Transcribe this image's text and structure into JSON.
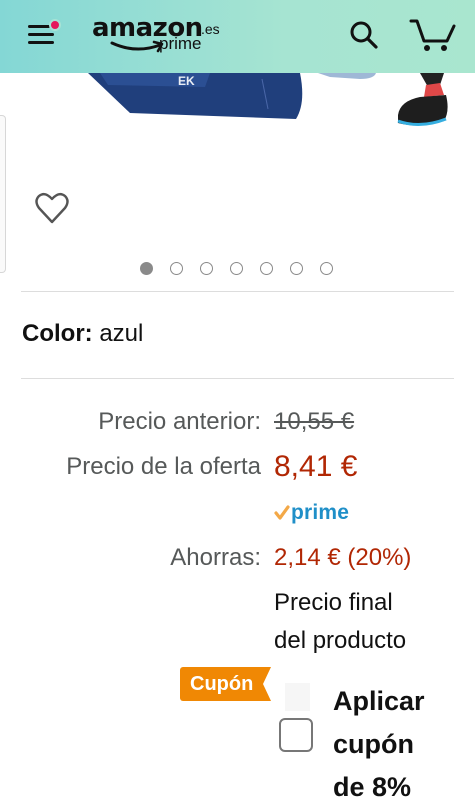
{
  "header": {
    "logo_word": "amazon",
    "logo_tld": ".es",
    "logo_prime": "prime",
    "colors": {
      "gradient_start": "#84d7d5",
      "gradient_end": "#a9e6cf",
      "notification": "#e5185c"
    },
    "icons": [
      "menu-icon",
      "search-icon",
      "cart-icon"
    ]
  },
  "gallery": {
    "total_images": 7,
    "active_index": 0,
    "favorite_icon": "heart-outline-icon"
  },
  "color": {
    "label": "Color:",
    "value": "azul"
  },
  "price": {
    "previous_label": "Precio anterior:",
    "previous_value": "10,55 €",
    "deal_label": "Precio de la oferta",
    "deal_value": "8,41 €",
    "prime_label": "prime",
    "savings_label": "Ahorras:",
    "savings_value": "2,14 € (20%)",
    "final_line1": "Precio final",
    "final_line2": "del producto",
    "accent_color": "#b12704"
  },
  "coupon": {
    "badge": "Cupón",
    "line1": "Aplicar",
    "line2": "cupón",
    "line3": "de 8%",
    "checked": false,
    "badge_color": "#f08804"
  }
}
